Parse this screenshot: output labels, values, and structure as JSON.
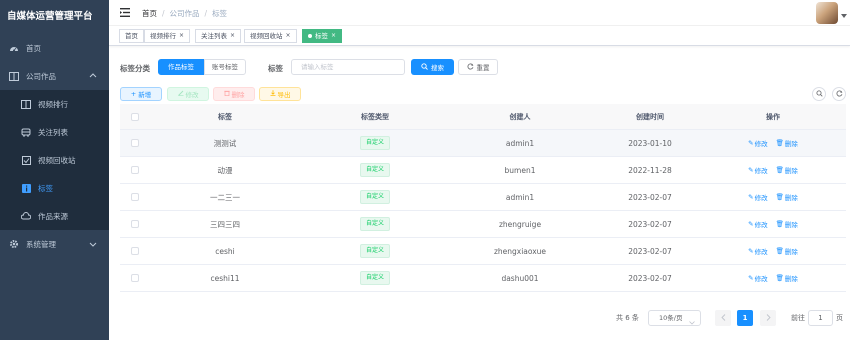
{
  "app": {
    "title": "自媒体运营管理平台"
  },
  "sidebar": {
    "home": "首页",
    "company_works": "公司作品",
    "sub_items": [
      "视频排行",
      "关注列表",
      "视频回收站",
      "标签",
      "作品来源"
    ],
    "system": "系统管理"
  },
  "header": {
    "breadcrumb": [
      "首页",
      "公司作品",
      "标签"
    ]
  },
  "tags_view": {
    "tabs": [
      "首页",
      "视频排行",
      "关注列表",
      "视频回收站",
      "标签"
    ],
    "active_index": 4
  },
  "filter": {
    "category_label": "标签分类",
    "radio_options": [
      "作品标签",
      "账号标签"
    ],
    "radio_selected": "作品标签",
    "tag_label": "标签",
    "tag_placeholder": "请输入标签",
    "search_label": "搜索",
    "reset_label": "重置"
  },
  "toolbar": {
    "add_label": "新增",
    "edit_label": "修改",
    "delete_label": "删除",
    "export_label": "导出"
  },
  "table": {
    "columns": [
      "标签",
      "标签类型",
      "创建人",
      "创建时间",
      "操作"
    ],
    "rows": [
      {
        "tag": "测测试",
        "type": "自定义",
        "creator": "admin1",
        "created": "2023-01-10"
      },
      {
        "tag": "动漫",
        "type": "自定义",
        "creator": "bumen1",
        "created": "2022-11-28"
      },
      {
        "tag": "一二三一",
        "type": "自定义",
        "creator": "admin1",
        "created": "2023-02-07"
      },
      {
        "tag": "三四三四",
        "type": "自定义",
        "creator": "zhengruige",
        "created": "2023-02-07"
      },
      {
        "tag": "ceshi",
        "type": "自定义",
        "creator": "zhengxiaoxue",
        "created": "2023-02-07"
      },
      {
        "tag": "ceshi11",
        "type": "自定义",
        "creator": "dashu001",
        "created": "2023-02-07"
      }
    ],
    "row_edit_label": "修改",
    "row_delete_label": "删除"
  },
  "pagination": {
    "total_text": "共 6 条",
    "page_size": "10条/页",
    "current_page": "1",
    "goto_label": "前往",
    "goto_value": "1",
    "page_unit": "页"
  },
  "colors": {
    "sidebar_bg": "#304156",
    "sidebar_active": "#409eff",
    "primary": "#1890ff",
    "tag_active": "#42b983",
    "badge_green": "#13ce66"
  }
}
